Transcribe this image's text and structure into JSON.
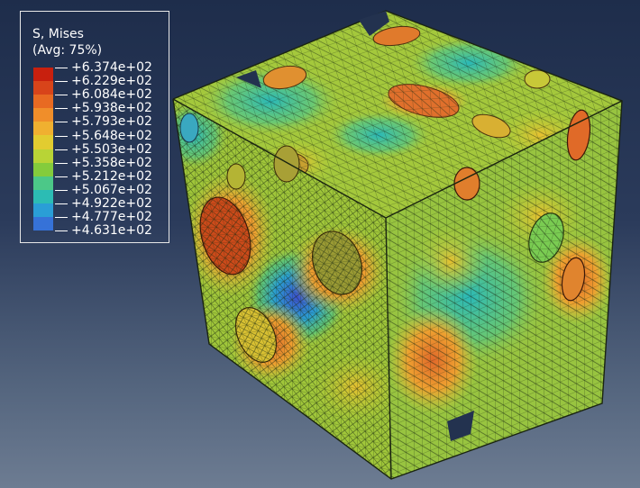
{
  "legend": {
    "title": "S, Mises",
    "subtitle": "(Avg: 75%)",
    "levels": [
      {
        "label": "+6.374e+02",
        "color": "#c8200e"
      },
      {
        "label": "+6.229e+02",
        "color": "#d8441a"
      },
      {
        "label": "+6.084e+02",
        "color": "#e86a22"
      },
      {
        "label": "+5.938e+02",
        "color": "#f08e2a"
      },
      {
        "label": "+5.793e+02",
        "color": "#f0b030"
      },
      {
        "label": "+5.648e+02",
        "color": "#e2cc30"
      },
      {
        "label": "+5.503e+02",
        "color": "#b8d436"
      },
      {
        "label": "+5.358e+02",
        "color": "#84cc3c"
      },
      {
        "label": "+5.212e+02",
        "color": "#4cc888"
      },
      {
        "label": "+5.067e+02",
        "color": "#2cbcb4"
      },
      {
        "label": "+4.922e+02",
        "color": "#2a9ed6"
      },
      {
        "label": "+4.777e+02",
        "color": "#3672d8"
      },
      {
        "label": "+4.631e+02",
        "color": "#3c46c8"
      }
    ]
  },
  "colors": {
    "background_top": "#1e2d4b",
    "background_bottom": "#6d7c92",
    "mesh_line": "#1a2a10",
    "mesh_base": "#a8c83a"
  }
}
